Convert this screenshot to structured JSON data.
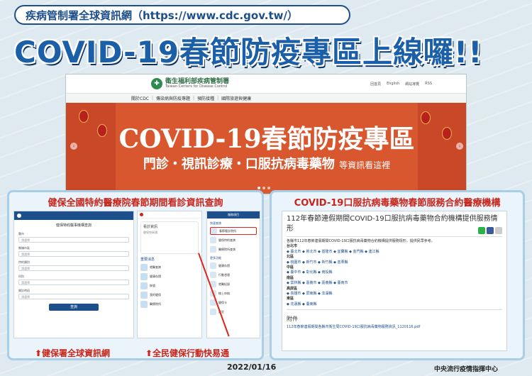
{
  "banner": {
    "url_label": "疾病管制署全球資訊網（https://www.cdc.gov.tw/）",
    "title": "COVID-19春節防疫專區上線囉!!"
  },
  "site": {
    "name_zh": "衛生福利部疾病管制署",
    "name_en": "Taiwan Centers for Disease Control",
    "tools": [
      "回首頁",
      "English",
      "網站導覽",
      "RSS"
    ],
    "nav": [
      "關於CDC",
      "傳染病與防疫專題",
      "預防接種",
      "國際旅遊與健康"
    ],
    "hero_title": "COVID-19春節防疫專區",
    "hero_sub": "門診・視訊診療・口服抗病毒藥物",
    "hero_sub_small": "等資訊看這裡"
  },
  "left_panel": {
    "title": "健保全國特約醫療院春節期間看診資訊查詢",
    "form": {
      "title": "健保特約醫事機構查詢",
      "fields": [
        {
          "label": "縣市",
          "value": "請選擇"
        },
        {
          "label": "鄉鎮市區",
          "value": "請選擇"
        },
        {
          "label": "特約類別",
          "value": "請選擇"
        },
        {
          "label": "科別",
          "value": "請選擇"
        },
        {
          "label": "開診時段",
          "value": "請選擇"
        }
      ],
      "button": "查詢"
    },
    "app": {
      "card_title": "看診資訊",
      "card_sub": "健保快易通",
      "section": "重要消息",
      "items": [
        "就醫查詢",
        "健康存摺",
        "掛號",
        "我的健保",
        "醫療院所"
      ]
    },
    "menu": {
      "header": "服務項目",
      "section1": "快速查詢",
      "items1": [
        "春節看診院所",
        "健保特約查詢",
        "醫療院所查詢"
      ],
      "section2": "更多功能",
      "items2": [
        "健康存摺",
        "行動憑證",
        "就醫紀錄",
        "線上申辦",
        "健保卡",
        "設定"
      ]
    },
    "caption_left": "⬆健保署全球資訊網",
    "caption_right": "⬆全民健保行動快易通"
  },
  "right_panel": {
    "title": "COVID-19口服抗病毒藥物春節服務合約醫療機構",
    "doc_title": "112年春節連假期間COVID-19口服抗病毒藥物合約機構提供服務情形",
    "intro": "各縣市112年春節連假期間COVID-19口服抗病毒藥物合約機構提供服務情形，提供民眾參考。",
    "regions": [
      {
        "name": "台北市",
        "links": "◆ 臺北市 ◆ 新北市 ◆ 基隆市 ◆ 宜蘭縣 ◆ 金門縣 ◆ 連江縣"
      },
      {
        "name": "北區",
        "links": "◆ 桃園市 ◆ 新竹市 ◆ 新竹縣 ◆ 苗栗縣"
      },
      {
        "name": "中區",
        "links": "◆ 臺中市 ◆ 彰化縣 ◆ 南投縣"
      },
      {
        "name": "南區",
        "links": "◆ 雲林縣 ◆ 嘉義市 ◆ 嘉義縣 ◆ 臺南市"
      },
      {
        "name": "高屏區",
        "links": "◆ 高雄市 ◆ 屏東縣 ◆ 澎湖縣"
      },
      {
        "name": "東區",
        "links": "◆ 花蓮縣 ◆ 臺東縣"
      }
    ],
    "attachment_heading": "附件",
    "attachment": "112年春節連假期間各縣市衛生局COVID-19口服抗病毒藥物服務資訊_1120116.pdf"
  },
  "footer": {
    "date": "2022/01/16",
    "org": "中央流行疫情指揮中心"
  },
  "colors": {
    "brand_blue": "#1b5fa8",
    "hero_orange": "#d9572f",
    "accent_red": "#c8251b",
    "panel_border": "#a8cfe7"
  }
}
